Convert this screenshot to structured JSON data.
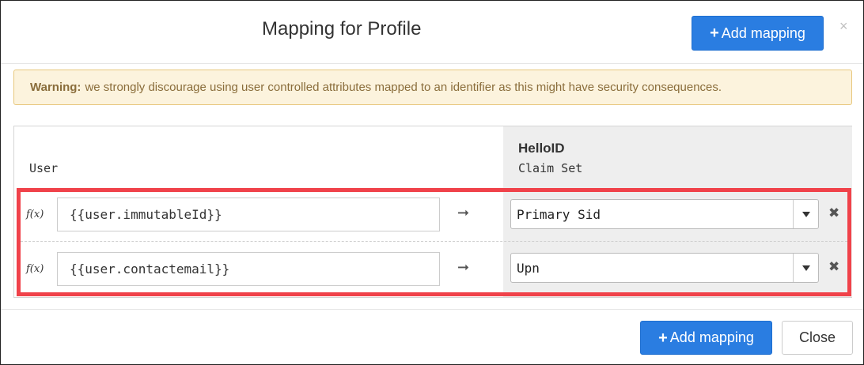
{
  "dialog": {
    "title": "Mapping for Profile",
    "close_symbol": "×"
  },
  "toolbar": {
    "add_mapping_label": "Add mapping",
    "plus_symbol": "+"
  },
  "warning": {
    "label": "Warning:",
    "text": "we strongly discourage using user controlled attributes mapped to an identifier as this might have security consequences."
  },
  "table": {
    "source_header": "User",
    "target_header_title": "HelloID",
    "target_header_subtitle": "Claim Set"
  },
  "mappings": [
    {
      "fx": "f(x)",
      "source": "{{user.immutableId}}",
      "arrow": "➞",
      "target": "Primary Sid",
      "remove": "✖"
    },
    {
      "fx": "f(x)",
      "source": "{{user.contactemail}}",
      "arrow": "➞",
      "target": "Upn",
      "remove": "✖"
    }
  ],
  "footer": {
    "add_mapping_label": "Add mapping",
    "close_label": "Close"
  },
  "colors": {
    "primary": "#2a7de1",
    "warning_bg": "#fcf3dd",
    "warning_text": "#8a6d3b",
    "highlight": "#f0424a"
  }
}
